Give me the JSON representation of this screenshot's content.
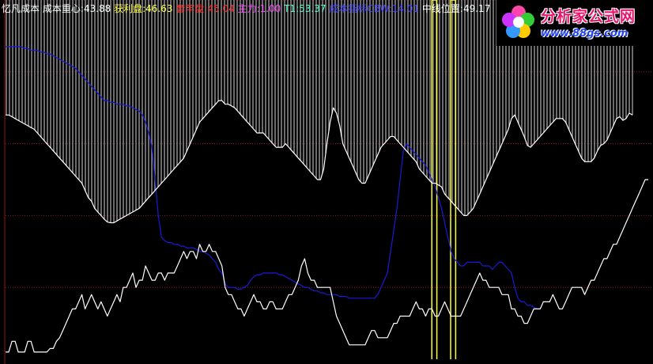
{
  "legend": {
    "name": "忆凡成本",
    "cost_center_label": "成本重心:",
    "cost_center_value": "43.88",
    "profit_label": "获利盘:",
    "profit_value": "46.63",
    "trapped_label": "套牢盘:",
    "trapped_value": "45.04",
    "main_force_label": "主力:",
    "main_force_value": "1.00",
    "t1_label": "T1:",
    "t1_value": "53.37",
    "cost_line_label": "成本指标CBW:",
    "cost_line_value": "14.01",
    "midline_label": "中线位置:",
    "midline_value": "49.17"
  },
  "logo": {
    "title": "分析家公式网",
    "url": "www.88gs.com"
  },
  "colors": {
    "background": "#000000",
    "hatch": "#9a9a9a",
    "white_line": "#ffffff",
    "blue_line": "#1a1ad8",
    "yellow_line": "#ffff33",
    "grid": "#8a1a1a",
    "label_red": "#ff3030",
    "label_magenta": "#ff44ff",
    "label_cyan": "#44ffcc",
    "label_blue": "#4444ff",
    "label_white": "#ffffff",
    "label_yellow": "#ffff44"
  },
  "chart_data": {
    "type": "line",
    "ylim": [
      0,
      100
    ],
    "grid_y": [
      20,
      40,
      60,
      80,
      100
    ],
    "series": [
      {
        "role": "upper-white",
        "values": [
          68,
          68,
          67.5,
          67,
          66.5,
          66,
          65.5,
          65,
          64.5,
          64,
          63,
          62,
          61,
          60,
          59,
          58,
          57,
          56,
          55,
          54,
          53,
          52,
          51,
          50,
          49,
          47,
          45,
          44,
          42,
          41,
          40,
          39,
          38.2,
          38,
          38,
          38.5,
          39,
          39.5,
          40,
          40.5,
          41,
          41.5,
          42,
          43,
          44,
          45,
          46,
          47,
          48,
          49,
          50,
          51,
          52,
          53,
          54,
          55,
          56,
          58,
          60,
          62,
          64,
          66,
          67,
          68,
          69,
          70,
          71,
          72,
          72,
          71,
          71,
          70.5,
          70,
          69,
          68,
          67,
          66,
          65,
          64,
          63,
          63,
          63,
          62,
          61,
          60,
          59,
          59,
          59,
          60,
          59,
          58,
          57,
          56,
          55,
          54,
          53,
          52,
          51,
          50,
          50,
          53,
          60,
          66,
          70,
          68.5,
          65,
          60,
          58,
          56,
          54,
          52,
          50,
          49,
          49,
          51,
          53,
          55,
          57,
          59,
          60,
          61,
          62,
          62,
          61,
          60,
          59,
          58,
          57,
          56,
          55,
          53,
          52,
          51,
          50,
          49,
          49,
          48.5,
          48,
          46,
          45,
          44,
          43,
          42,
          41,
          40,
          40,
          41,
          42,
          44,
          46,
          48,
          50,
          52,
          54,
          56,
          58,
          60,
          62,
          64,
          67,
          68,
          66,
          64,
          62,
          59.5,
          59,
          60,
          61,
          62,
          63,
          64,
          65,
          66,
          67,
          67,
          67,
          66,
          64,
          62,
          60,
          58,
          56,
          55,
          55,
          55,
          56,
          58,
          59.5,
          60,
          61,
          63,
          65,
          67,
          67.5,
          66.5,
          67,
          68.5,
          68
        ],
        "color": "#ffffff"
      },
      {
        "role": "lower-white",
        "values": [
          2,
          2,
          5,
          5,
          2,
          2,
          2,
          5,
          5,
          2,
          2,
          2,
          2,
          2,
          3,
          3,
          5,
          6,
          8,
          10,
          12,
          14,
          14,
          16,
          18,
          14,
          16,
          18,
          16,
          14,
          16,
          14,
          12,
          14,
          16,
          18,
          16,
          20,
          20,
          22,
          24,
          20,
          22,
          22,
          26,
          24,
          22,
          22,
          24,
          24,
          22,
          24,
          24,
          24,
          26,
          28,
          30,
          28,
          30,
          30,
          28,
          32,
          30,
          30,
          32,
          30,
          30,
          28,
          26,
          20,
          18,
          18,
          16,
          14,
          14,
          12,
          14,
          16,
          18,
          16,
          16,
          14,
          14,
          16,
          16,
          14,
          14,
          14,
          16,
          18,
          18,
          20,
          22,
          26,
          28,
          24,
          22,
          22,
          20,
          20,
          20,
          20,
          20,
          16,
          12,
          10,
          8,
          6,
          4,
          4,
          4,
          4,
          4,
          4,
          6,
          8,
          8,
          6,
          6,
          6,
          6,
          8,
          10,
          10,
          12,
          12,
          12,
          12,
          14,
          16,
          14,
          14,
          12,
          14,
          14,
          12,
          12,
          14,
          16,
          14,
          12,
          12,
          12,
          12,
          14,
          16,
          18,
          20,
          22,
          24,
          22,
          22,
          20,
          20,
          20,
          20,
          18,
          18,
          18,
          14,
          14,
          12,
          12,
          10,
          10,
          12,
          14,
          14,
          14,
          16,
          16,
          16,
          18,
          16,
          14,
          14,
          16,
          18,
          20,
          20,
          20,
          20,
          18,
          20,
          22,
          22,
          24,
          26,
          28,
          28,
          30,
          32,
          32,
          34,
          36,
          38,
          40,
          42,
          44,
          46,
          48,
          50,
          50
        ],
        "color": "#ffffff"
      },
      {
        "role": "blue",
        "values": [
          87,
          87,
          87,
          87,
          87,
          87,
          86.5,
          86.5,
          86,
          86,
          86,
          85.5,
          85.5,
          85,
          85,
          84.5,
          84,
          83.5,
          83,
          82.5,
          82,
          81.5,
          81,
          80,
          79,
          78,
          77,
          76,
          75,
          74,
          73,
          72,
          72,
          71.5,
          71.5,
          71,
          71,
          71,
          70.5,
          70.5,
          70,
          69.5,
          69,
          68,
          66,
          63,
          59,
          50,
          40,
          34,
          33,
          32.5,
          32.5,
          32,
          32,
          31.5,
          31.5,
          31,
          31,
          31,
          30.5,
          30,
          30,
          29.5,
          29,
          28,
          27,
          25,
          24,
          21,
          20,
          20,
          20,
          19.5,
          19.5,
          20,
          20.5,
          22,
          23,
          23.5,
          23.5,
          24,
          24,
          24,
          24,
          24,
          23.5,
          23.5,
          23,
          22.5,
          22,
          21.5,
          21,
          20.5,
          20,
          20,
          19.5,
          19,
          19,
          18.5,
          18.5,
          18,
          18,
          18,
          18,
          17.5,
          17.5,
          17.5,
          17,
          17,
          17,
          17,
          17,
          17,
          17,
          17,
          17,
          18,
          20,
          22,
          24,
          30,
          36,
          42,
          50,
          58,
          60,
          59,
          58,
          57,
          56,
          55,
          54,
          52,
          50,
          48,
          45,
          42,
          38,
          34,
          30,
          28,
          27,
          26,
          26,
          27,
          27,
          27,
          27,
          27,
          26,
          26,
          26,
          25,
          26,
          27,
          27,
          26,
          25,
          24,
          20,
          17,
          16,
          16,
          15,
          15,
          14.5,
          14,
          14
        ],
        "color": "#1a1ad8"
      }
    ],
    "yellow_bars": [
      {
        "x_from": 0.68,
        "x_to": 0.688
      },
      {
        "x_from": 0.71,
        "x_to": 0.718
      }
    ]
  }
}
